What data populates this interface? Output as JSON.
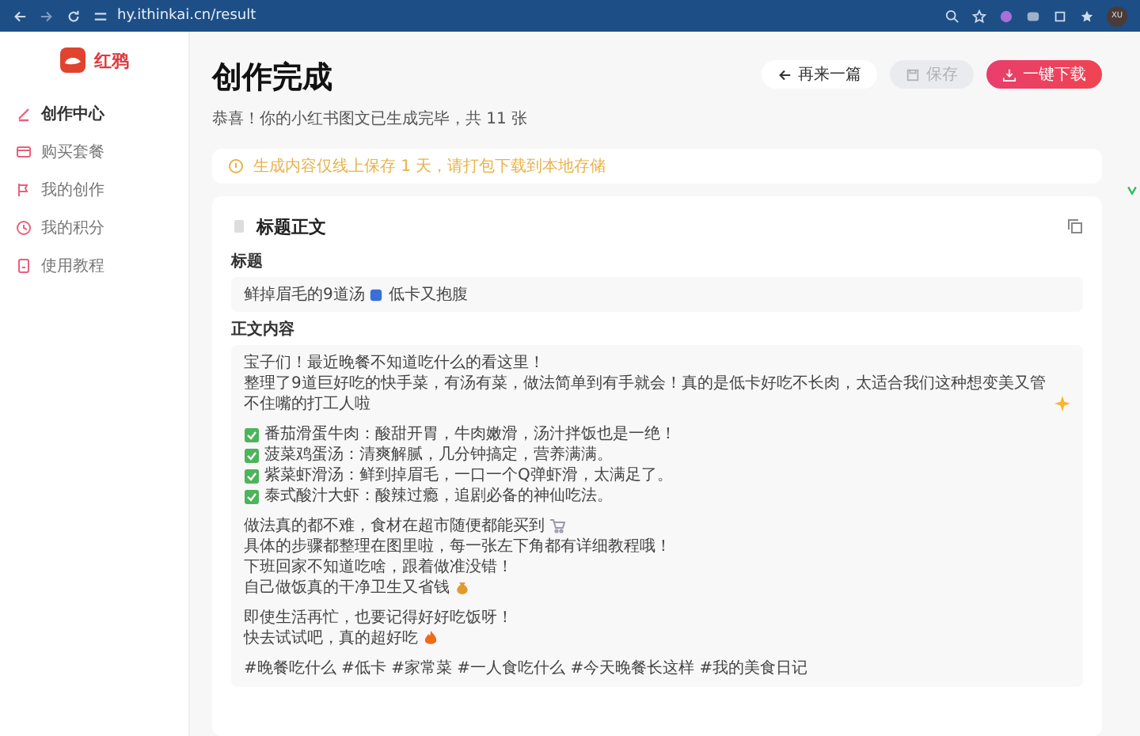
{
  "browser": {
    "url": "hy.ithinkai.cn/result",
    "avatar": "XU"
  },
  "sidebar": {
    "logo": "红鸦",
    "items": [
      {
        "label": "创作中心",
        "selected": true
      },
      {
        "label": "购买套餐",
        "selected": false
      },
      {
        "label": "我的创作",
        "selected": false
      },
      {
        "label": "我的积分",
        "selected": false
      },
      {
        "label": "使用教程",
        "selected": false
      }
    ]
  },
  "page": {
    "title": "创作完成",
    "subtitle": "恭喜！你的小红书图文已生成完毕，共 11 张"
  },
  "actions": [
    {
      "label": "再来一篇",
      "kind": "back",
      "disabled": false
    },
    {
      "label": "保存",
      "kind": "save",
      "disabled": true
    },
    {
      "label": "一键下载",
      "kind": "download",
      "disabled": false
    }
  ],
  "notice": "生成内容仅线上保存 1 天，请打包下载到本地存储",
  "card": {
    "heading": "标题正文",
    "title_label": "标题",
    "title_before": "鲜掉眉毛的9道汤",
    "title_after": "低卡又抱腹",
    "body_label": "正文内容",
    "lines": [
      {
        "kind": "text",
        "text": "宝子们！最近晚餐不知道吃什么的看这里！"
      },
      {
        "kind": "text",
        "text": "整理了9道巨好吃的快手菜，有汤有菜，做法简单到有手就会！真的是低卡好吃不长肉，太适合我们这种想变美又管不住嘴的打工人啦"
      },
      {
        "kind": "blank"
      },
      {
        "kind": "check",
        "text": "番茄滑蛋牛肉：酸甜开胃，牛肉嫩滑，汤汁拌饭也是一绝！"
      },
      {
        "kind": "check",
        "text": "菠菜鸡蛋汤：清爽解腻，几分钟搞定，营养满满。"
      },
      {
        "kind": "check",
        "text": "紫菜虾滑汤：鲜到掉眉毛，一口一个Q弹虾滑，太满足了。"
      },
      {
        "kind": "check",
        "text": "泰式酸汁大虾：酸辣过瘾，追剧必备的神仙吃法。"
      },
      {
        "kind": "blank"
      },
      {
        "kind": "text",
        "text": "做法真的都不难，食材在超市随便都能买到"
      },
      {
        "kind": "text",
        "text": "具体的步骤都整理在图里啦，每一张左下角都有详细教程哦！"
      },
      {
        "kind": "text",
        "text": "下班回家不知道吃啥，跟着做准没错！"
      },
      {
        "kind": "text",
        "text": "自己做饭真的干净卫生又省钱"
      },
      {
        "kind": "blank"
      },
      {
        "kind": "text",
        "text": "即使生活再忙，也要记得好好吃饭呀！"
      },
      {
        "kind": "text",
        "text": "快去试试吧，真的超好吃"
      },
      {
        "kind": "blank"
      },
      {
        "kind": "text",
        "text": "#晚餐吃什么 #低卡 #家常菜 #一人食吃什么 #今天晚餐长这样 #我的美食日记"
      }
    ]
  }
}
